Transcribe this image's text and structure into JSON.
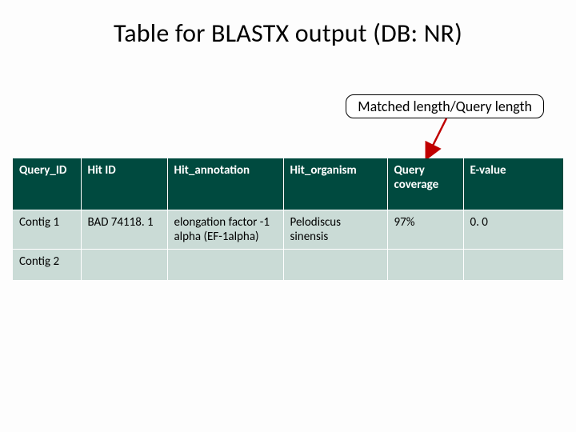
{
  "title": "Table for BLASTX output (DB: NR)",
  "callout": "Matched length/Query length",
  "table": {
    "headers": [
      "Query_ID",
      "Hit ID",
      "Hit_annotation",
      "Hit_organism",
      "Query coverage",
      "E-value"
    ],
    "rows": [
      {
        "query_id": "Contig 1",
        "hit_id": "BAD 74118. 1",
        "hit_annotation": "elongation factor -1 alpha (EF-1alpha)",
        "hit_organism": "Pelodiscus sinensis",
        "query_coverage": "97%",
        "e_value": "0. 0"
      },
      {
        "query_id": "Contig 2",
        "hit_id": "",
        "hit_annotation": "",
        "hit_organism": "",
        "query_coverage": "",
        "e_value": ""
      }
    ]
  },
  "chart_data": {
    "type": "table",
    "title": "Table for BLASTX output (DB: NR)",
    "columns": [
      "Query_ID",
      "Hit ID",
      "Hit_annotation",
      "Hit_organism",
      "Query coverage",
      "E-value"
    ],
    "rows": [
      [
        "Contig 1",
        "BAD 74118. 1",
        "elongation factor -1 alpha (EF-1alpha)",
        "Pelodiscus sinensis",
        "97%",
        "0. 0"
      ],
      [
        "Contig 2",
        "",
        "",
        "",
        "",
        ""
      ]
    ],
    "annotation": "Matched length/Query length (points to Query coverage column)"
  }
}
